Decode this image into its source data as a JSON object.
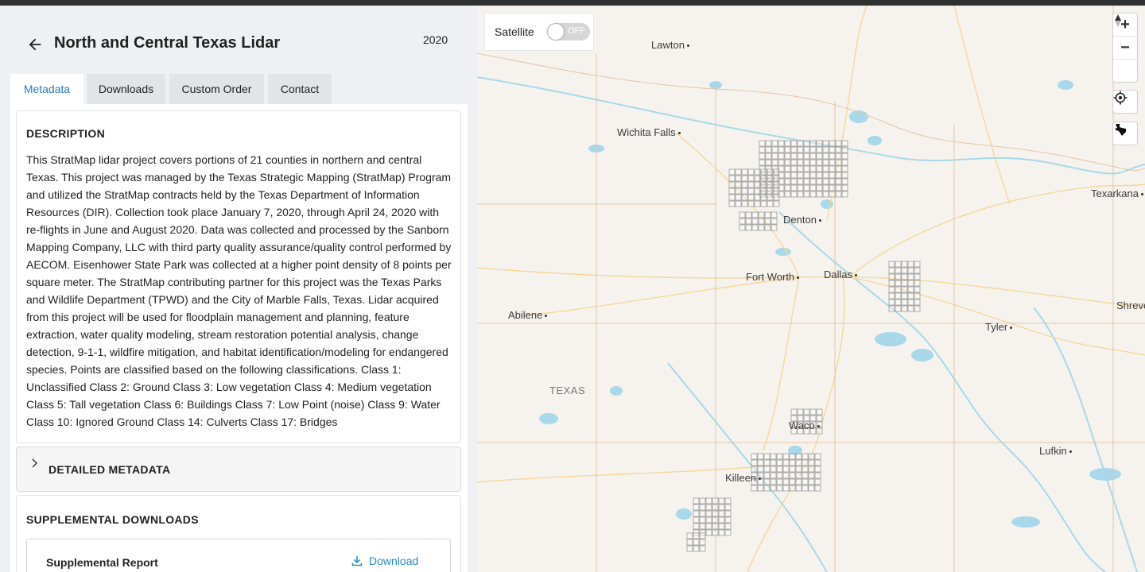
{
  "header": {
    "title": "North and Central Texas Lidar",
    "year": "2020"
  },
  "tabs": [
    {
      "label": "Metadata",
      "active": true
    },
    {
      "label": "Downloads",
      "active": false
    },
    {
      "label": "Custom Order",
      "active": false
    },
    {
      "label": "Contact",
      "active": false
    }
  ],
  "description": {
    "heading": "DESCRIPTION",
    "text": "This StratMap lidar project covers portions of 21 counties in northern and central Texas. This project was managed by the Texas Strategic Mapping (StratMap) Program and utilized the StratMap contracts held by the Texas Department of Information Resources (DIR). Collection took place January 7, 2020, through April 24, 2020 with re-flights in June and August 2020. Data was collected and processed by the Sanborn Mapping Company, LLC with third party quality assurance/quality control performed by AECOM. Eisenhower State Park was collected at a higher point density of 8 points per square meter. The StratMap contributing partner for this project was the Texas Parks and Wildlife Department (TPWD) and the City of Marble Falls, Texas. Lidar acquired from this project will be used for floodplain management and planning, feature extraction, water quality modeling, stream restoration potential analysis, change detection, 9-1-1, wildfire mitigation, and habitat identification/modeling for endangered species. Points are classified based on the following classifications. Class 1: Unclassified Class 2: Ground Class 3: Low vegetation Class 4: Medium vegetation Class 5: Tall vegetation Class 6: Buildings Class 7: Low Point (noise) Class 9: Water Class 10: Ignored Ground Class 14: Culverts Class 17: Bridges"
  },
  "detailed_metadata": {
    "heading": "DETAILED METADATA"
  },
  "supplemental": {
    "heading": "SUPPLEMENTAL DOWNLOADS",
    "items": [
      {
        "name": "Supplemental Report",
        "action_label": "Download"
      }
    ]
  },
  "map": {
    "satellite_label": "Satellite",
    "satellite_toggle": "OFF",
    "state_label": "TEXAS",
    "cities": [
      "Lawton",
      "Wichita Falls",
      "Denton",
      "Fort Worth",
      "Dallas",
      "Abilene",
      "Tyler",
      "Texarkana",
      "Shreve",
      "Waco",
      "Killeen",
      "Lufkin"
    ],
    "controls": {
      "zoom_in": "+",
      "zoom_out": "−"
    }
  },
  "colors": {
    "accent": "#2a7ab8",
    "tile_outline": "#9a9a9a",
    "water": "#a8d8ea",
    "road": "#f5d79a"
  }
}
